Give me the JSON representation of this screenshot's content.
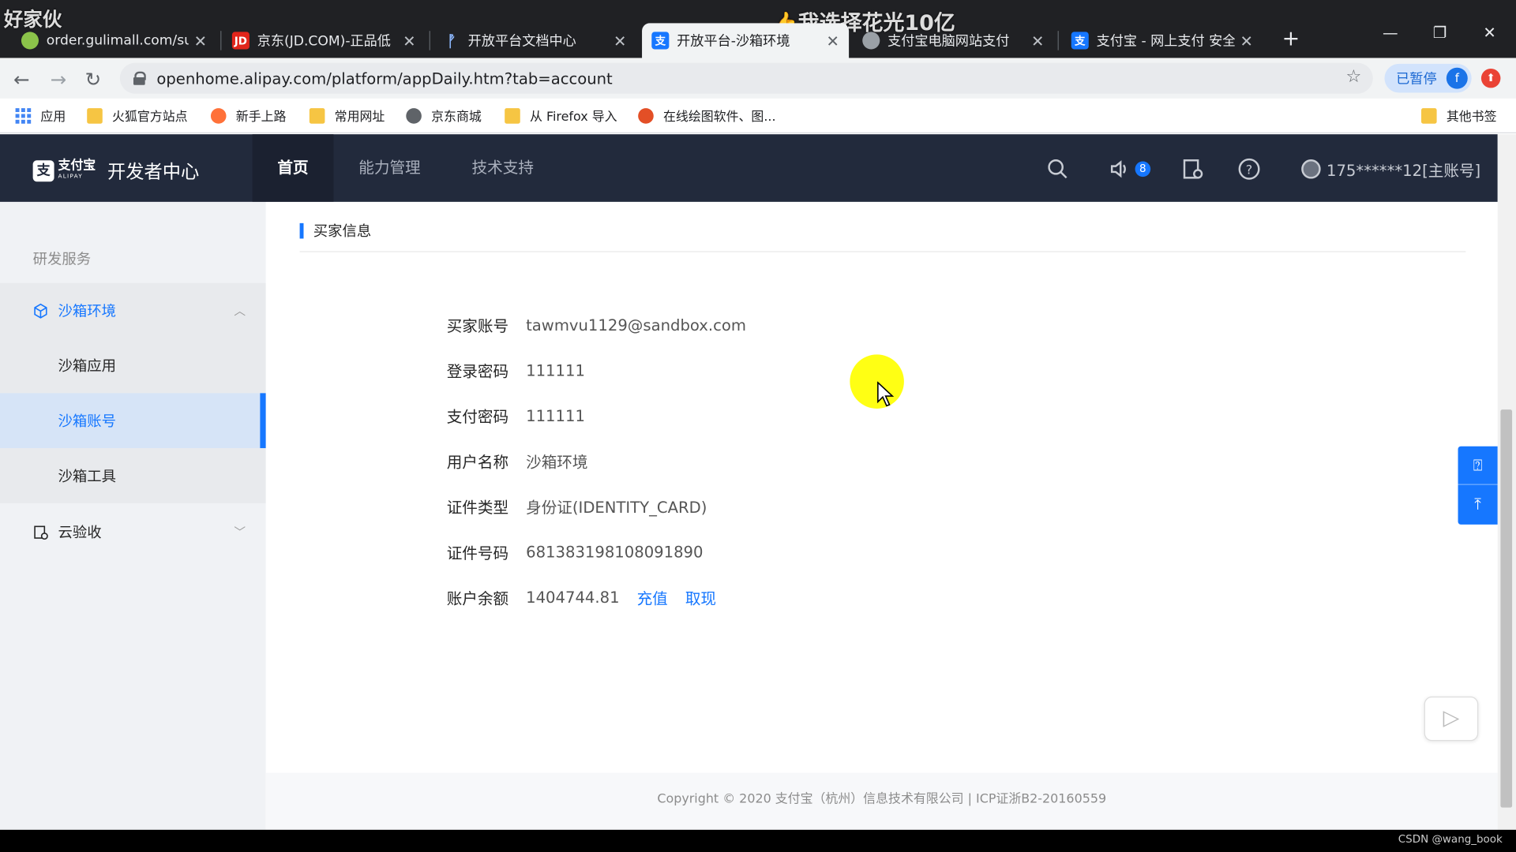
{
  "browser": {
    "tabs": [
      {
        "title": "order.gulimall.com/su",
        "favicon_color": "#8bc34a",
        "favicon_text": "",
        "active": false
      },
      {
        "title": "京东(JD.COM)-正品低",
        "favicon_color": "#e1251b",
        "favicon_text": "JD",
        "active": false
      },
      {
        "title": "开放平台文档中心",
        "favicon_color": "#1677ff",
        "favicon_text": "",
        "active": false
      },
      {
        "title": "开放平台-沙箱环境",
        "favicon_color": "#1677ff",
        "favicon_text": "支",
        "active": true
      },
      {
        "title": "支付宝电脑网站支付",
        "favicon_color": "#9aa0a6",
        "favicon_text": "",
        "active": false
      },
      {
        "title": "支付宝 - 网上支付 安全",
        "favicon_color": "#1677ff",
        "favicon_text": "支",
        "active": false
      }
    ],
    "new_tab": "+",
    "url": "openhome.alipay.com/platform/appDaily.htm?tab=account",
    "profile_status": "已暂停",
    "profile_initial": "f",
    "bookmarks": [
      "应用",
      "火狐官方站点",
      "新手上路",
      "常用网址",
      "京东商城",
      "从 Firefox 导入",
      "在线绘图软件、图...",
      "其他书签"
    ]
  },
  "overlay": {
    "top_left": "好家伙",
    "top_center": "👍我选择花光10亿",
    "bottom_right": "CSDN @wang_book"
  },
  "header": {
    "logo_mark": "支",
    "logo_brand": "支付宝",
    "logo_sub": "ALIPAY",
    "title": "开发者中心",
    "nav": [
      "首页",
      "能力管理",
      "技术支持"
    ],
    "notification_count": "8",
    "account": "175******12[主账号]"
  },
  "sidebar": {
    "section": "研发服务",
    "group": "沙箱环境",
    "items": [
      "沙箱应用",
      "沙箱账号",
      "沙箱工具"
    ],
    "group2": "云验收"
  },
  "main": {
    "section_title": "买家信息",
    "fields": [
      {
        "label": "买家账号",
        "value": "tawmvu1129@sandbox.com"
      },
      {
        "label": "登录密码",
        "value": "111111"
      },
      {
        "label": "支付密码",
        "value": "111111"
      },
      {
        "label": "用户名称",
        "value": "沙箱环境"
      },
      {
        "label": "证件类型",
        "value": "身份证(IDENTITY_CARD)"
      },
      {
        "label": "证件号码",
        "value": "681383198108091890"
      },
      {
        "label": "账户余额",
        "value": "1404744.81"
      }
    ],
    "recharge": "充值",
    "withdraw": "取现",
    "footer": "Copyright © 2020 支付宝（杭州）信息技术有限公司  |  ICP证浙B2-20160559"
  },
  "colors": {
    "accent": "#1677ff",
    "header_bg": "#222a3c",
    "highlight": "#ffff00"
  }
}
